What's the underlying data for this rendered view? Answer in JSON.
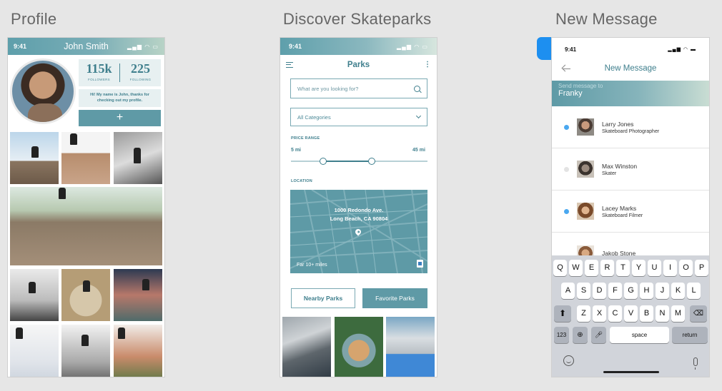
{
  "sections": {
    "profile": "Profile",
    "discover": "Discover Skateparks",
    "message": "New Message"
  },
  "profile": {
    "time": "9:41",
    "user_name": "John Smith",
    "followers_count": "115k",
    "followers_label": "FOLLOWERS",
    "following_count": "225",
    "following_label": "FOLLOWING",
    "bio": "Hi! My name is John, thanks for checking out my profile.",
    "add_label": "+"
  },
  "discover": {
    "time": "9:41",
    "title": "Parks",
    "search_placeholder": "What are you looking for?",
    "category_value": "All Categories",
    "price_range_label": "PRICE RANGE",
    "range_min": "5 mi",
    "range_max": "45 mi",
    "location_label": "LOCATION",
    "address_line1": "1000 Redondo Ave.",
    "address_line2": "Long Beach, CA 90804",
    "distance_text": "Far 10+ miles",
    "nearby_button": "Nearby Parks",
    "favorite_button": "Favorite Parks"
  },
  "message": {
    "time": "9:41",
    "title": "New Message",
    "to_placeholder": "Send message to",
    "to_value": "Franky",
    "contacts": [
      {
        "name": "Larry Jones",
        "role": "Skateboard Photographer",
        "online": true
      },
      {
        "name": "Max Winston",
        "role": "Skater",
        "online": false
      },
      {
        "name": "Lacey Marks",
        "role": "Skateboard Filmer",
        "online": true
      },
      {
        "name": "Jakob Stone",
        "role": "",
        "online": false
      }
    ],
    "keyboard": {
      "row1": [
        "Q",
        "W",
        "E",
        "R",
        "T",
        "Y",
        "U",
        "I",
        "O",
        "P"
      ],
      "row2": [
        "A",
        "S",
        "D",
        "F",
        "G",
        "H",
        "J",
        "K",
        "L"
      ],
      "row3": [
        "Z",
        "X",
        "C",
        "V",
        "B",
        "N",
        "M"
      ],
      "numbers_key": "123",
      "space_key": "space",
      "return_key": "return"
    }
  },
  "colors": {
    "accent": "#5f9aa6",
    "accent_dark": "#3f7f8d",
    "online_dot": "#4aa8f0"
  }
}
